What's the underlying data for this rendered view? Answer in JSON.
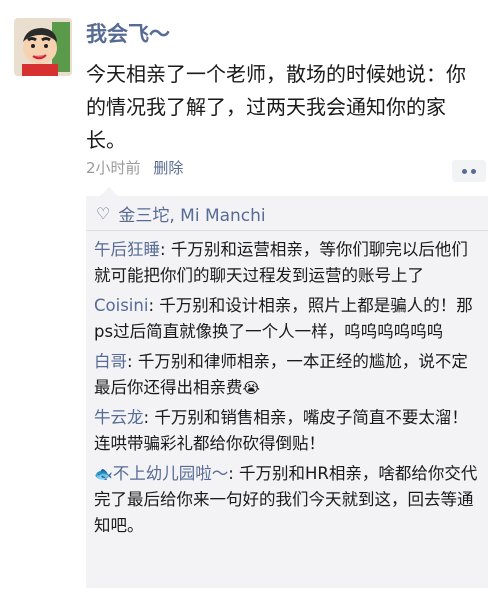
{
  "post": {
    "username": "我会飞～",
    "text": "今天相亲了一个老师，散场的时候她说：你的情况我了解了，过两天我会通知你的家长。",
    "time": "2小时前",
    "delete_label": "删除"
  },
  "likes": {
    "names": "金三坨, Mi Manchi"
  },
  "comments": [
    {
      "author": "午后狂睡",
      "text": "千万别和运营相亲，等你们聊完以后他们就可能把你们的聊天过程发到运营的账号上了"
    },
    {
      "author": "Coisini",
      "text": "千万别和设计相亲，照片上都是骗人的！那ps过后简直就像换了一个人一样，呜呜呜呜呜呜"
    },
    {
      "author": "白哥",
      "text": "千万别和律师相亲，一本正经的尴尬，说不定最后你还得出相亲费"
    },
    {
      "author": "牛云龙",
      "text": "千万别和销售相亲，嘴皮子简直不要太溜！连哄带骗彩礼都给你砍得倒贴！"
    },
    {
      "author": "不上幼儿园啦～",
      "text": "千万别和HR相亲，啥都给你交代完了最后给你来一句好的我们今天就到这，回去等通知吧。"
    }
  ],
  "colors": {
    "link": "#576b95",
    "comment_bg": "#f3f3f5",
    "meta": "#9a9a9a"
  },
  "icons": {
    "like": "heart-outline-icon",
    "more": "more-dots-icon",
    "crying": "crying-emoji-icon",
    "fish": "fish-icon"
  }
}
